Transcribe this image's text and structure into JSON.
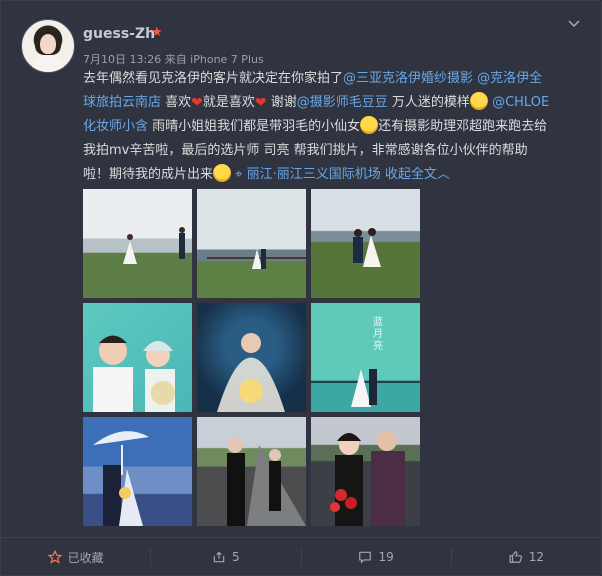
{
  "post": {
    "username": "guess-Zh",
    "meta": "7月10日 13:26 来自 iPhone 7 Plus",
    "text": {
      "p1": "去年偶然看见克洛伊的客片就决定在你家拍了",
      "link1": "@三亚克洛伊婚纱摄影",
      "link2": "@克洛伊全球旅拍云南店",
      "p2": " 喜欢",
      "p3": "就是喜欢",
      "p4": " 谢谢",
      "link3": "@摄影师毛豆豆",
      "p5": " 万人迷的模样",
      "link4": "@CHLOE化妆师小含",
      "p6": " 雨晴小姐姐我们都是带羽毛的小仙女",
      "p7": "还有摄影助理邓超跑来跑去给我拍mv辛苦啦，最后的选片师 司亮 帮我们挑片，非常感谢各位小伙伴的帮助啦！期待我的成片出来",
      "location": "丽江·丽江三义国际机场",
      "collapse": "收起全文"
    }
  },
  "footer": {
    "favorite": "已收藏",
    "repost": "5",
    "comment": "19",
    "like": "12"
  },
  "icons": {
    "vip": "vip-star-icon",
    "menu": "chevron-down-icon",
    "location": "location-pin-icon"
  }
}
